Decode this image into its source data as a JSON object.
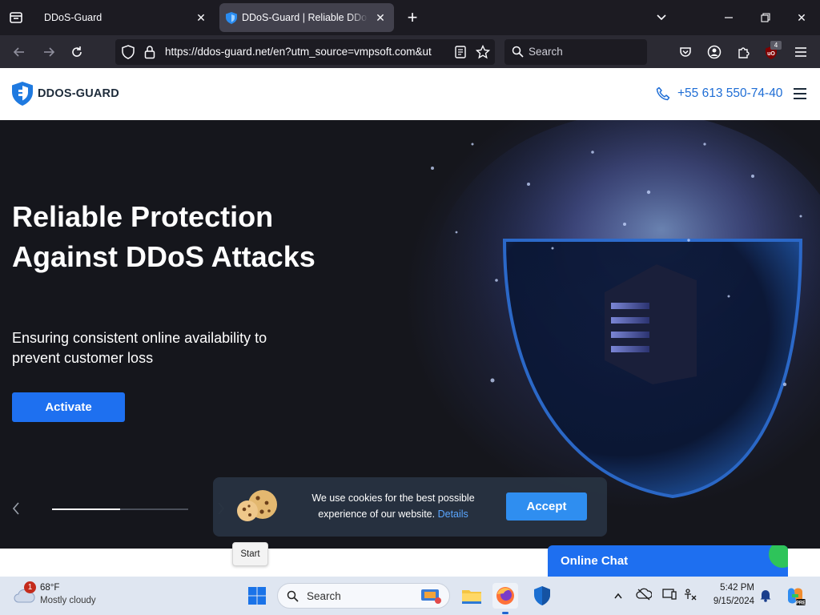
{
  "browser": {
    "tabs": [
      {
        "title": "DDoS-Guard",
        "active": false
      },
      {
        "title": "DDoS-Guard | Reliable DDoS Pr",
        "active": true
      }
    ],
    "url": "https://ddos-guard.net/en?utm_source=vmpsoft.com&ut",
    "search_placeholder": "Search",
    "extension_badge": "4",
    "colors": {
      "chrome_dark": "#1c1b22",
      "toolbar": "#2b2a33",
      "active_tab": "#42414d"
    }
  },
  "site": {
    "logo_text": "DDOS-GUARD",
    "phone": "+55 613 550-74-40",
    "hero": {
      "title": "Reliable Protection Against DDoS Attacks",
      "subtitle": "Ensuring consistent online availability to prevent customer loss",
      "cta": "Activate",
      "slider_progress": 0.5
    },
    "cookie": {
      "text": "We use cookies for the best possible experience of our website.",
      "details_link": "Details",
      "accept": "Accept"
    },
    "chat_label": "Online Chat",
    "colors": {
      "brand_blue": "#1e70f0",
      "link": "#1e6dd5",
      "hero_bg": "#15161c",
      "chat_online": "#2ec45a"
    }
  },
  "taskbar": {
    "tooltip": "Start",
    "weather": {
      "temp": "68°F",
      "condition": "Mostly cloudy",
      "badge": "1"
    },
    "search_placeholder": "Search",
    "time": "5:42 PM",
    "date": "9/15/2024",
    "pinned_apps": [
      "start-icon",
      "file-explorer-icon",
      "firefox-icon",
      "defender-icon"
    ],
    "tray_icons": [
      "chevron-up-icon",
      "cloud-offline-icon",
      "display-icon",
      "accessibility-icon",
      "notification-bell-icon",
      "copilot-icon"
    ]
  }
}
